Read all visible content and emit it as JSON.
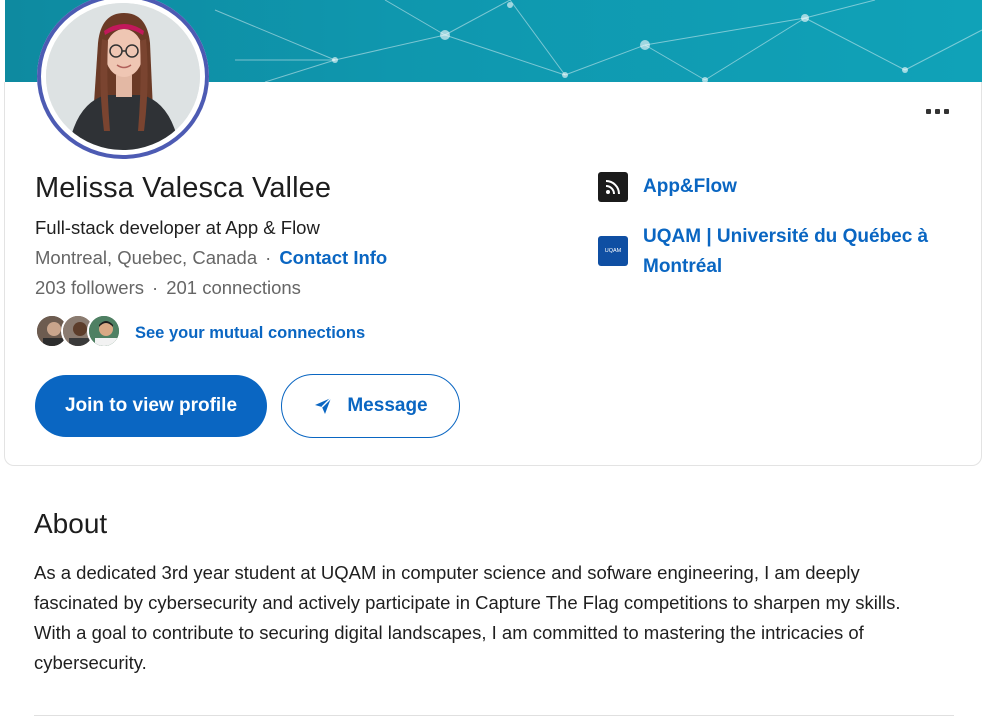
{
  "profile": {
    "name": "Melissa Valesca Vallee",
    "headline": "Full-stack developer at App & Flow",
    "location": "Montreal, Quebec, Canada",
    "contact_info": "Contact Info",
    "followers": "203 followers",
    "connections": "201 connections",
    "mutual_link": "See your mutual connections"
  },
  "actions": {
    "join_label": "Join to view profile",
    "message_label": "Message",
    "more_icon": "ellipsis-icon"
  },
  "orgs": [
    {
      "name": "App&Flow",
      "logo": "rss-logo-icon",
      "logo_color": "#1b1b1b"
    },
    {
      "name_line1": "UQAM | Université du Québec à",
      "name_line2": "Montréal",
      "logo": "uqam-logo",
      "logo_text": "UQAM",
      "logo_color": "#0f4fa3"
    }
  ],
  "about": {
    "title": "About",
    "text": "As a dedicated 3rd year student at UQAM in computer science and sofware engineering, I am deeply fascinated by cybersecurity and actively participate in Capture The Flag competitions to sharpen my skills. With a goal to contribute to securing digital landscapes, I am committed to mastering the intricacies of cybersecurity."
  },
  "colors": {
    "accent": "#0a66c2",
    "banner": "#0f97ae",
    "avatar_ring": "#4d5bb3"
  }
}
